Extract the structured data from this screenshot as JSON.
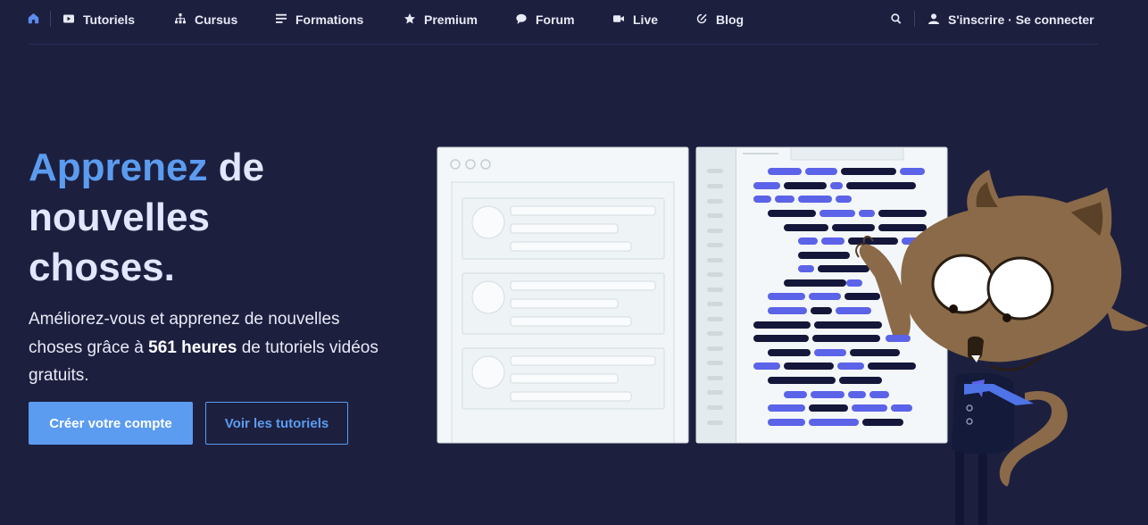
{
  "nav": {
    "items": [
      {
        "label": "Tutoriels",
        "icon": "play-icon"
      },
      {
        "label": "Cursus",
        "icon": "sitemap-icon"
      },
      {
        "label": "Formations",
        "icon": "list-icon"
      },
      {
        "label": "Premium",
        "icon": "star-icon"
      },
      {
        "label": "Forum",
        "icon": "chat-bubble-icon"
      },
      {
        "label": "Live",
        "icon": "video-camera-icon"
      },
      {
        "label": "Blog",
        "icon": "edit-icon"
      }
    ],
    "auth_label": "S'inscrire · Se connecter"
  },
  "hero": {
    "title_accent": "Apprenez",
    "title_rest_1": " de",
    "title_line_2": "nouvelles",
    "title_line_3": "choses.",
    "text_before": "Améliorez-vous et apprenez de nouvelles choses grâce à ",
    "text_highlight": "561 heures",
    "text_after": " de tutoriels vidéos gratuits.",
    "primary_button": "Créer votre compte",
    "secondary_button": "Voir les tutoriels"
  },
  "colors": {
    "background": "#1d1f3f",
    "accent": "#5b9cf0",
    "code_blue": "#5b63e8",
    "code_dark": "#14173a"
  }
}
